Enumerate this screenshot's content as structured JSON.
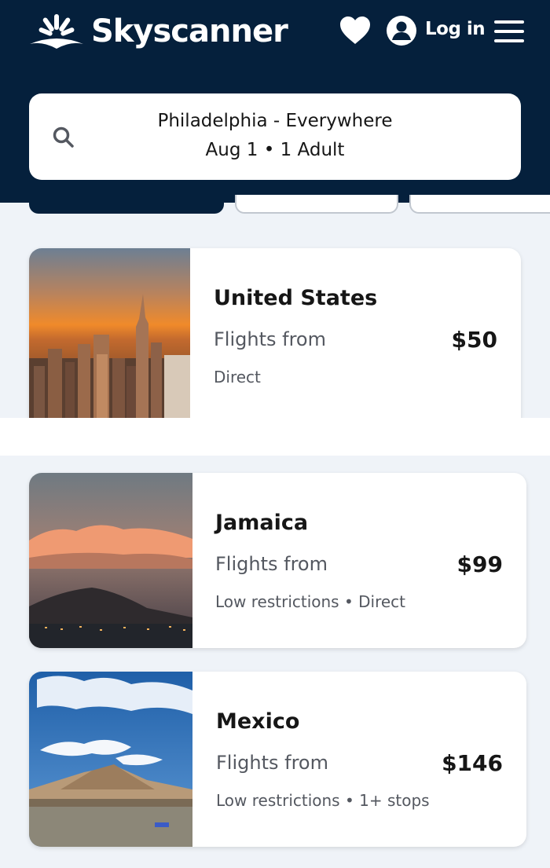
{
  "header": {
    "brand": "Skyscanner",
    "login_label": "Log in"
  },
  "search": {
    "route": "Philadelphia - Everywhere",
    "details": "Aug 1  •  1 Adult"
  },
  "results": [
    {
      "destination": "United States",
      "subtitle": "Flights from",
      "price": "$50",
      "tags": "Direct"
    },
    {
      "destination": "Jamaica",
      "subtitle": "Flights from",
      "price": "$99",
      "tags": "Low restrictions • Direct"
    },
    {
      "destination": "Mexico",
      "subtitle": "Flights from",
      "price": "$146",
      "tags": "Low restrictions • 1+ stops"
    }
  ],
  "icons": [
    "logo-sunrise-icon",
    "heart-icon",
    "user-icon",
    "menu-icon",
    "search-icon"
  ],
  "colors": {
    "header_bg": "#05203c",
    "page_bg": "#eff3f8",
    "text": "#161616",
    "muted": "#545860"
  }
}
